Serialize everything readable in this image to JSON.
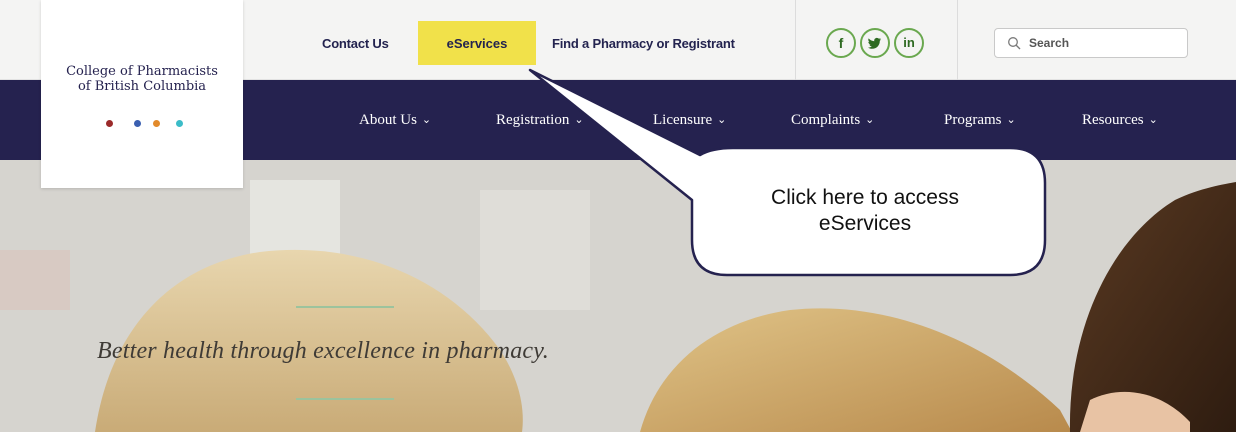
{
  "logo": {
    "title_line1": "College of Pharmacists",
    "title_line2": "of British Columbia",
    "dot_colors": [
      "#9b2a2a",
      "#3a5fb0",
      "#e28a2b",
      "#3bbcc8"
    ]
  },
  "utility_nav": {
    "contact_label": "Contact Us",
    "eservices_label": "eServices",
    "find_label": "Find a Pharmacy or Registrant",
    "highlight_color": "#f1e14a"
  },
  "social": {
    "facebook": "f",
    "twitter": "🐦",
    "linkedin": "in",
    "color": "#6aa84f"
  },
  "search": {
    "placeholder": "Search",
    "icon": "search-icon"
  },
  "main_nav": {
    "items": [
      {
        "label": "About Us"
      },
      {
        "label": "Registration"
      },
      {
        "label": "Licensure"
      },
      {
        "label": "Complaints"
      },
      {
        "label": "Programs"
      },
      {
        "label": "Resources"
      }
    ],
    "caret": "⌄",
    "background": "#25224f"
  },
  "hero": {
    "tagline": "Better health through excellence in pharmacy."
  },
  "callout": {
    "line1": "Click here to access",
    "line2": "eServices"
  }
}
